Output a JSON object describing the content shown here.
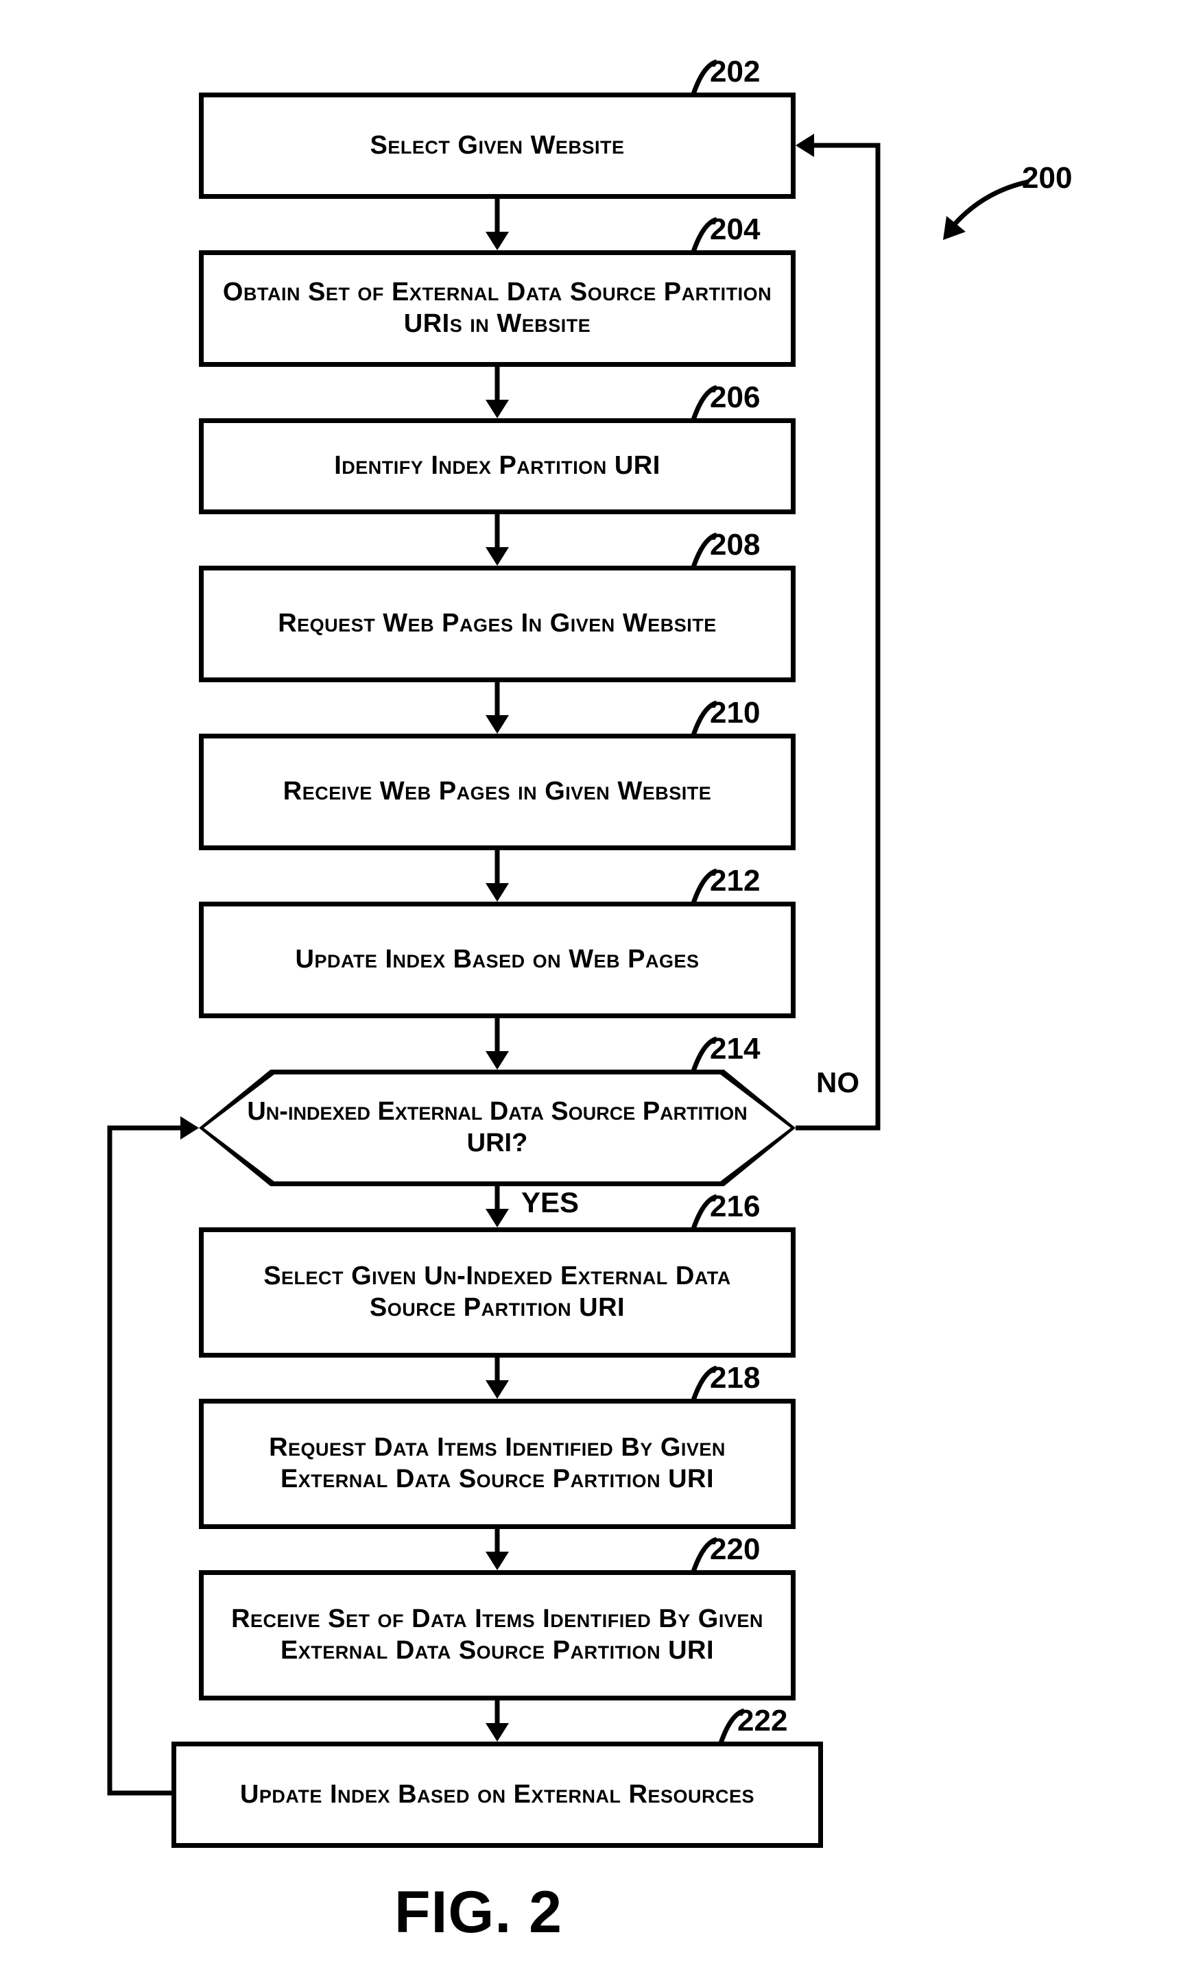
{
  "figure_label": "FIG. 2",
  "diagram_ref": "200",
  "decision": {
    "text": "Un-indexed External Data Source Partition URI?",
    "ref": "214",
    "yes_label": "YES",
    "no_label": "NO"
  },
  "steps": {
    "s202": {
      "text": "Select Given Website",
      "ref": "202"
    },
    "s204": {
      "text": "Obtain Set of External Data Source Partition URIs in Website",
      "ref": "204"
    },
    "s206": {
      "text": "Identify Index Partition URI",
      "ref": "206"
    },
    "s208": {
      "text": "Request Web Pages In Given Website",
      "ref": "208"
    },
    "s210": {
      "text": "Receive Web Pages in Given Website",
      "ref": "210"
    },
    "s212": {
      "text": "Update Index Based on Web Pages",
      "ref": "212"
    },
    "s216": {
      "text": "Select Given Un-Indexed External Data Source Partition URI",
      "ref": "216"
    },
    "s218": {
      "text": "Request Data Items Identified By Given External Data Source Partition URI",
      "ref": "218"
    },
    "s220": {
      "text": "Receive Set of Data Items Identified By Given External Data Source Partition URI",
      "ref": "220"
    },
    "s222": {
      "text": "Update Index Based on External Resources",
      "ref": "222"
    }
  }
}
